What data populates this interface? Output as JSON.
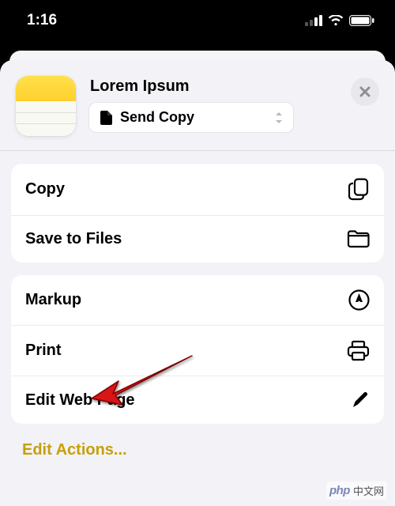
{
  "status": {
    "time": "1:16"
  },
  "header": {
    "title": "Lorem Ipsum",
    "send_copy_label": "Send Copy"
  },
  "sections": [
    {
      "items": [
        {
          "label": "Copy",
          "icon": "copy-icon"
        },
        {
          "label": "Save to Files",
          "icon": "folder-icon"
        }
      ]
    },
    {
      "items": [
        {
          "label": "Markup",
          "icon": "markup-icon"
        },
        {
          "label": "Print",
          "icon": "printer-icon"
        },
        {
          "label": "Edit Web Page",
          "icon": "pencil-icon"
        }
      ]
    }
  ],
  "footer": {
    "edit_actions": "Edit Actions..."
  },
  "watermark": {
    "php": "php",
    "text": "中文网"
  }
}
